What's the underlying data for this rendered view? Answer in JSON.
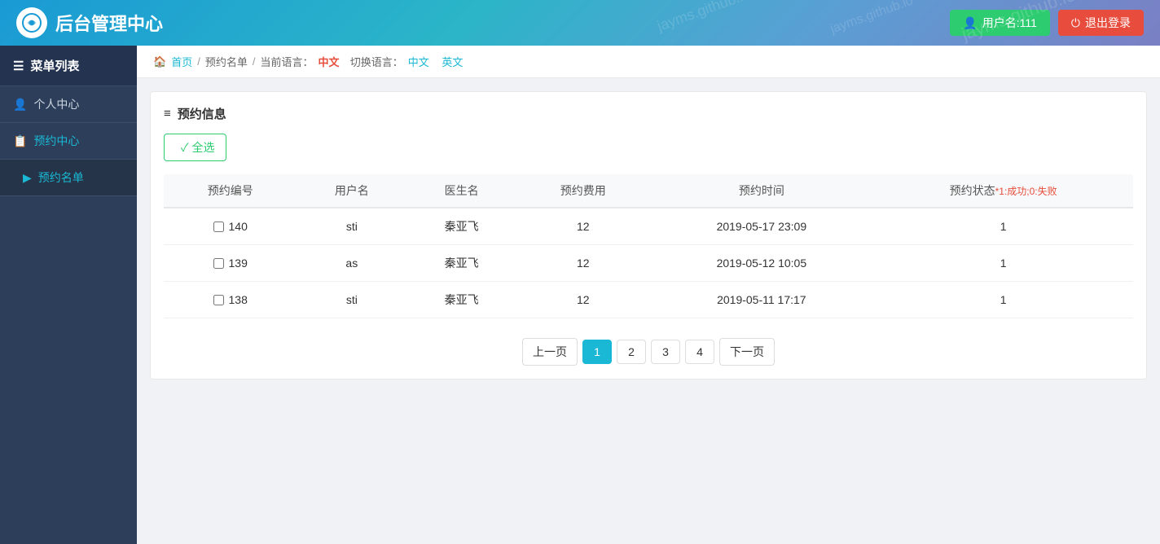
{
  "header": {
    "logo_text": "✕",
    "title": "后台管理中心",
    "user_label": "用户名:111",
    "logout_label": "退出登录"
  },
  "breadcrumb": {
    "home": "首页",
    "sep1": "/",
    "list": "预约名单",
    "sep2": "/",
    "current_lang_prefix": "当前语言：",
    "current_lang": "中文",
    "switch_prefix": "切换语言：",
    "lang_zh": "中文",
    "lang_en": "英文"
  },
  "sidebar": {
    "header": "菜单列表",
    "items": [
      {
        "label": "个人中心",
        "icon": "👤",
        "level": "top"
      },
      {
        "label": "预约中心",
        "icon": "📋",
        "level": "top"
      },
      {
        "label": "预约名单",
        "icon": "▶",
        "level": "sub",
        "active": true
      }
    ]
  },
  "card": {
    "title": "预约信息",
    "select_all": "✓ 全选"
  },
  "table": {
    "columns": [
      "预约编号",
      "用户名",
      "医生名",
      "预约费用",
      "预约时间",
      "预约状态"
    ],
    "status_note": "*1:成功;0:失败",
    "rows": [
      {
        "id": "140",
        "username": "sti",
        "doctor": "秦亚飞",
        "fee": "12",
        "time": "2019-05-17 23:09",
        "status": "1"
      },
      {
        "id": "139",
        "username": "as",
        "doctor": "秦亚飞",
        "fee": "12",
        "time": "2019-05-12 10:05",
        "status": "1"
      },
      {
        "id": "138",
        "username": "sti",
        "doctor": "秦亚飞",
        "fee": "12",
        "time": "2019-05-11 17:17",
        "status": "1"
      }
    ]
  },
  "pagination": {
    "prev": "上一页",
    "next": "下一页",
    "pages": [
      "1",
      "2",
      "3",
      "4"
    ],
    "active_page": "1"
  },
  "watermark": {
    "lines": [
      "jayms.github.io",
      "jayms.github.io",
      "jayms.github.io"
    ]
  }
}
